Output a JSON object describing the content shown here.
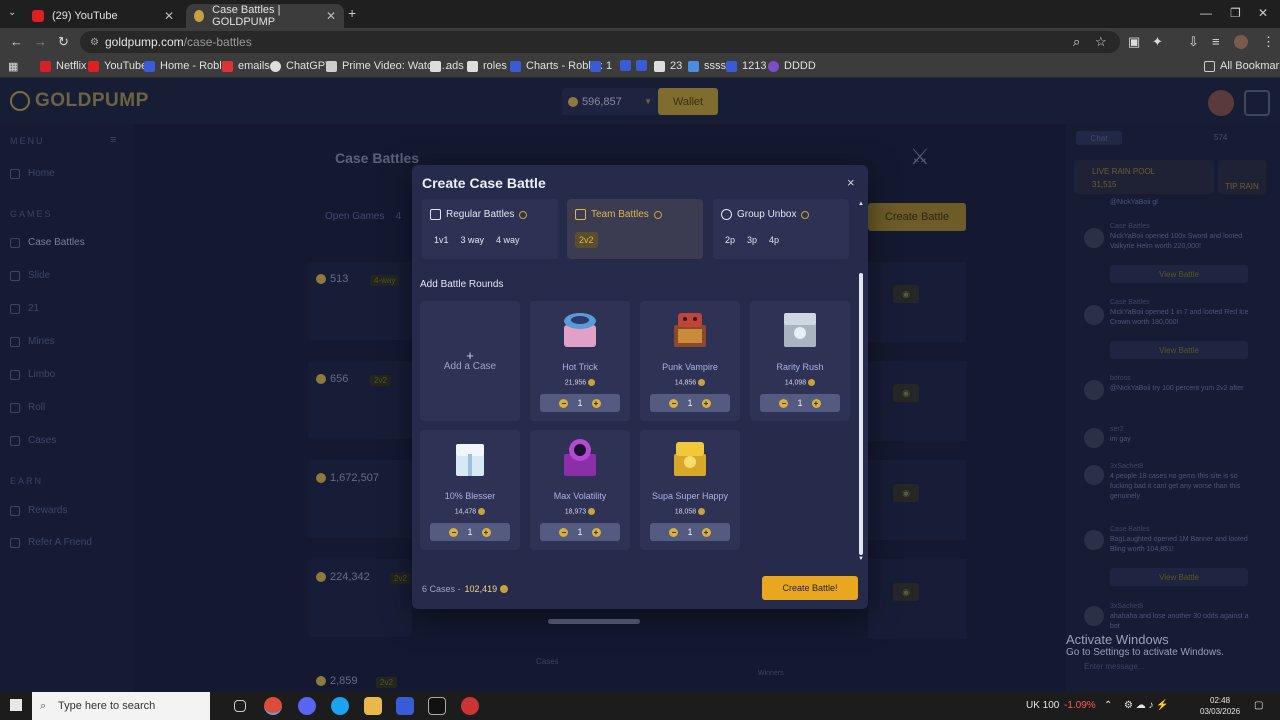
{
  "browser": {
    "tabs": [
      {
        "title": "(29) YouTube"
      },
      {
        "title": "Case Battles | GOLDPUMP"
      }
    ],
    "url_domain": "goldpump.com",
    "url_path": "/case-battles",
    "bookmarks": [
      "Netflix",
      "YouTube",
      "Home - Roblox",
      "emails",
      "ChatGPT",
      "Prime Video: Watch...",
      "ads",
      "roles",
      "Charts - Roblox",
      "1",
      "23",
      "ssss",
      "1213",
      "DDDD"
    ],
    "all_bookmarks": "All Bookmarks"
  },
  "site": {
    "logo_text": "GOLDPUMP",
    "balance": "596,857",
    "wallet_label": "Wallet",
    "sidebar": {
      "menu_label": "MENU",
      "menu_items": [
        "Home"
      ],
      "games_label": "GAMES",
      "games_items": [
        "Case Battles",
        "Slide",
        "21",
        "Mines",
        "Limbo",
        "Roll",
        "Cases"
      ],
      "earn_label": "EARN",
      "earn_items": [
        "Rewards",
        "Refer A Friend"
      ]
    },
    "page_title": "Case Battles",
    "open_games_label": "Open Games",
    "open_games_count": "4",
    "create_battle_label": "Create Battle",
    "background_games": [
      {
        "price": "513",
        "mode": "4-way"
      },
      {
        "price": "656",
        "mode": "2v2"
      },
      {
        "price": "1,672,507",
        "mode": "2v2"
      },
      {
        "price": "224,342",
        "mode": "2v2"
      },
      {
        "price": "2,859",
        "mode": "2v2"
      }
    ],
    "cases_label": "Cases",
    "winners_label": "Winners"
  },
  "chat": {
    "tab_label": "Chat",
    "online": "574",
    "rain_title": "LIVE RAIN POOL",
    "rain_amount": "31,515",
    "tip_rain": "TIP RAIN",
    "messages": [
      {
        "user": "Case Battles",
        "text": "NickYaBoii opened 100x Sword and looted Valkyrie Helm worth 220,000!",
        "button": "View Battle"
      },
      {
        "user": "Case Battles",
        "text": "NickYaBoii opened 1 in 7 and looted Red Ice Crown worth 180,000!",
        "button": "View Battle"
      },
      {
        "user": "botoss",
        "text": "@NickYaBoii try 100 percent yum 2v2 after"
      },
      {
        "user": "ser2",
        "text": "im gay"
      },
      {
        "user": "3xSachet8",
        "text": "4 people 18 cases no gems this site is so fucking bad it cant get any worse than this genuinely"
      },
      {
        "user": "Case Battles",
        "text": "BagLaughted opened 1M Banner and looted Bling worth 104,851!",
        "button": "View Battle"
      },
      {
        "user": "3xSachet8",
        "text": "ahahaha and lose another 30 odds against a bot"
      }
    ],
    "top_message": "@NickYaBoii gl",
    "input_placeholder": "Enter message..."
  },
  "modal": {
    "title": "Create Case Battle",
    "close": "×",
    "modes": [
      {
        "name": "Regular Battles",
        "options": [
          "1v1",
          "3 way",
          "4 way"
        ],
        "selected": false
      },
      {
        "name": "Team Battles",
        "options": [
          "2v2"
        ],
        "selected": true
      },
      {
        "name": "Group Unbox",
        "options": [
          "2p",
          "3p",
          "4p"
        ],
        "selected": false
      }
    ],
    "rounds_label": "Add Battle Rounds",
    "add_case_label": "Add a Case",
    "cases": [
      {
        "name": "Hot Trick",
        "price": "21,956",
        "qty": "1",
        "color": "#9a7bd0"
      },
      {
        "name": "Punk Vampire",
        "price": "14,856",
        "qty": "1",
        "color": "#b3553b"
      },
      {
        "name": "Rarity Rush",
        "price": "14,098",
        "qty": "1",
        "color": "#bfc9d4"
      },
      {
        "name": "10% Blesser",
        "price": "14,478",
        "qty": "1",
        "color": "#d6e6f2"
      },
      {
        "name": "Max Volatility",
        "price": "18,973",
        "qty": "1",
        "color": "#9a3fb4"
      },
      {
        "name": "Supa Super Happy",
        "price": "18,058",
        "qty": "1",
        "color": "#e6bf3a"
      }
    ],
    "footer_cases": "6 Cases",
    "footer_sep": "-",
    "footer_total": "102,419",
    "create_button": "Create Battle!"
  },
  "windows": {
    "activate_title": "Activate Windows",
    "activate_sub": "Go to Settings to activate Windows.",
    "search_placeholder": "Type here to search",
    "ticker": "UK 100",
    "ticker_change": "-1.09%",
    "time": "02:48",
    "date": "03/03/2026"
  },
  "colors": {
    "accent": "#e8a71f",
    "modal_bg": "#262b4b",
    "page_bg": "#151a30"
  }
}
